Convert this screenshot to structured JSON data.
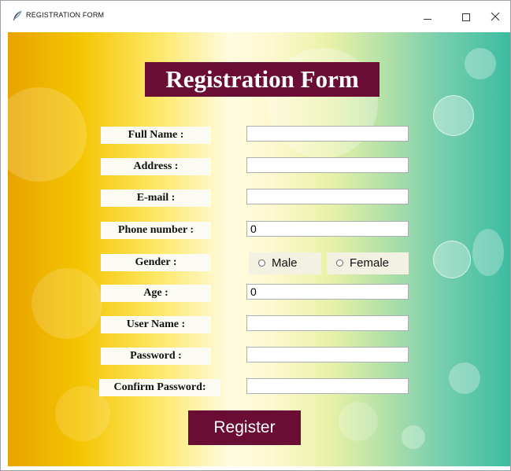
{
  "window": {
    "title": "REGISTRATION FORM",
    "icon": "feather-icon",
    "controls": [
      "minimize-icon",
      "maximize-icon",
      "close-icon"
    ]
  },
  "form": {
    "title": "Registration Form",
    "fields": [
      {
        "label": "Full Name :",
        "value": ""
      },
      {
        "label": "Address :",
        "value": ""
      },
      {
        "label": "E-mail :",
        "value": ""
      },
      {
        "label": "Phone number :",
        "value": "0"
      },
      {
        "label": "Age :",
        "value": "0"
      },
      {
        "label": "User Name :",
        "value": ""
      },
      {
        "label": "Password :",
        "value": ""
      },
      {
        "label": "Confirm Password:",
        "value": ""
      }
    ],
    "gender": {
      "label": "Gender :",
      "options": [
        "Male",
        "Female"
      ]
    },
    "register_label": "Register"
  },
  "colors": {
    "accent": "#6b0c34",
    "label_background": "#fbfbf4"
  }
}
